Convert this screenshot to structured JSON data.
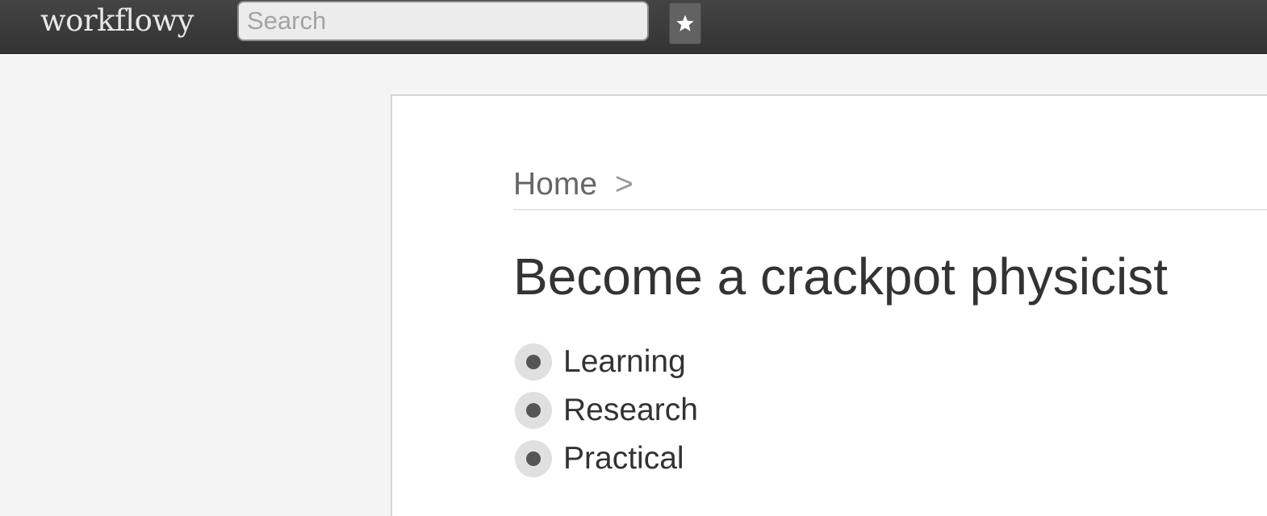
{
  "header": {
    "logo": "workflowy",
    "search": {
      "placeholder": "Search",
      "value": ""
    },
    "star_icon": "star-icon"
  },
  "breadcrumb": {
    "home": "Home",
    "separator": ">"
  },
  "main": {
    "title": "Become a crackpot physicist",
    "items": [
      {
        "label": "Learning",
        "icon": "bullet-icon"
      },
      {
        "label": "Research",
        "icon": "bullet-icon"
      },
      {
        "label": "Practical",
        "icon": "bullet-icon"
      }
    ]
  },
  "colors": {
    "topbar": "#3a3a3a",
    "background": "#f4f4f4",
    "panel": "#ffffff",
    "text": "#333333",
    "bullet_ring": "#e0e0e0",
    "bullet_dot": "#555555"
  }
}
